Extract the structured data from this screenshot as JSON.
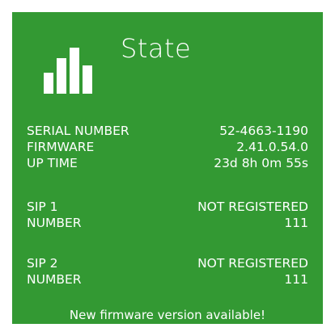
{
  "tile": {
    "title": "State",
    "icon": "bar-chart-icon",
    "background_color": "#339933",
    "text_color": "#ffffff"
  },
  "device": {
    "serial_number": {
      "label": "SERIAL NUMBER",
      "value": "52-4663-1190"
    },
    "firmware": {
      "label": "FIRMWARE",
      "value": "2.41.0.54.0"
    },
    "up_time": {
      "label": "UP TIME",
      "value": "23d 8h 0m 55s"
    }
  },
  "sip1": {
    "label": "SIP 1",
    "status": "NOT REGISTERED",
    "number_label": "NUMBER",
    "number": "111"
  },
  "sip2": {
    "label": "SIP 2",
    "status": "NOT REGISTERED",
    "number_label": "NUMBER",
    "number": "111"
  },
  "notice": {
    "text": "New firmware version available!"
  }
}
